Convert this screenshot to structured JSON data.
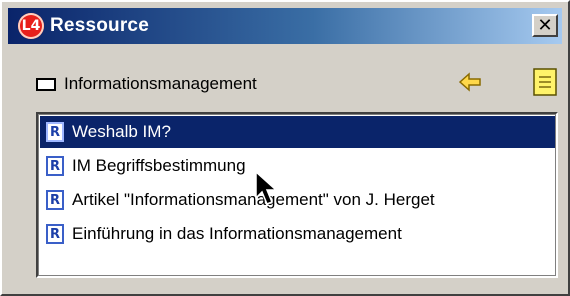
{
  "window": {
    "title": "Ressource",
    "app_icon_text": "L4",
    "close_label": "✕",
    "titlebar_colors": [
      "#0a246a",
      "#a6caf0"
    ]
  },
  "header": {
    "label": "Informationsmanagement",
    "back_icon": "back-arrow-icon",
    "note_icon": "note-icon"
  },
  "resources": {
    "items": [
      {
        "label": "Weshalb IM?",
        "selected": true
      },
      {
        "label": "IM Begriffsbestimmung",
        "selected": false
      },
      {
        "label": "Artikel \"Informationsmanagement\" von J. Herget",
        "selected": false
      },
      {
        "label": "Einführung in das Informationsmanagement",
        "selected": false
      }
    ],
    "icon_letter": "R",
    "selection_color": "#0a246a"
  }
}
